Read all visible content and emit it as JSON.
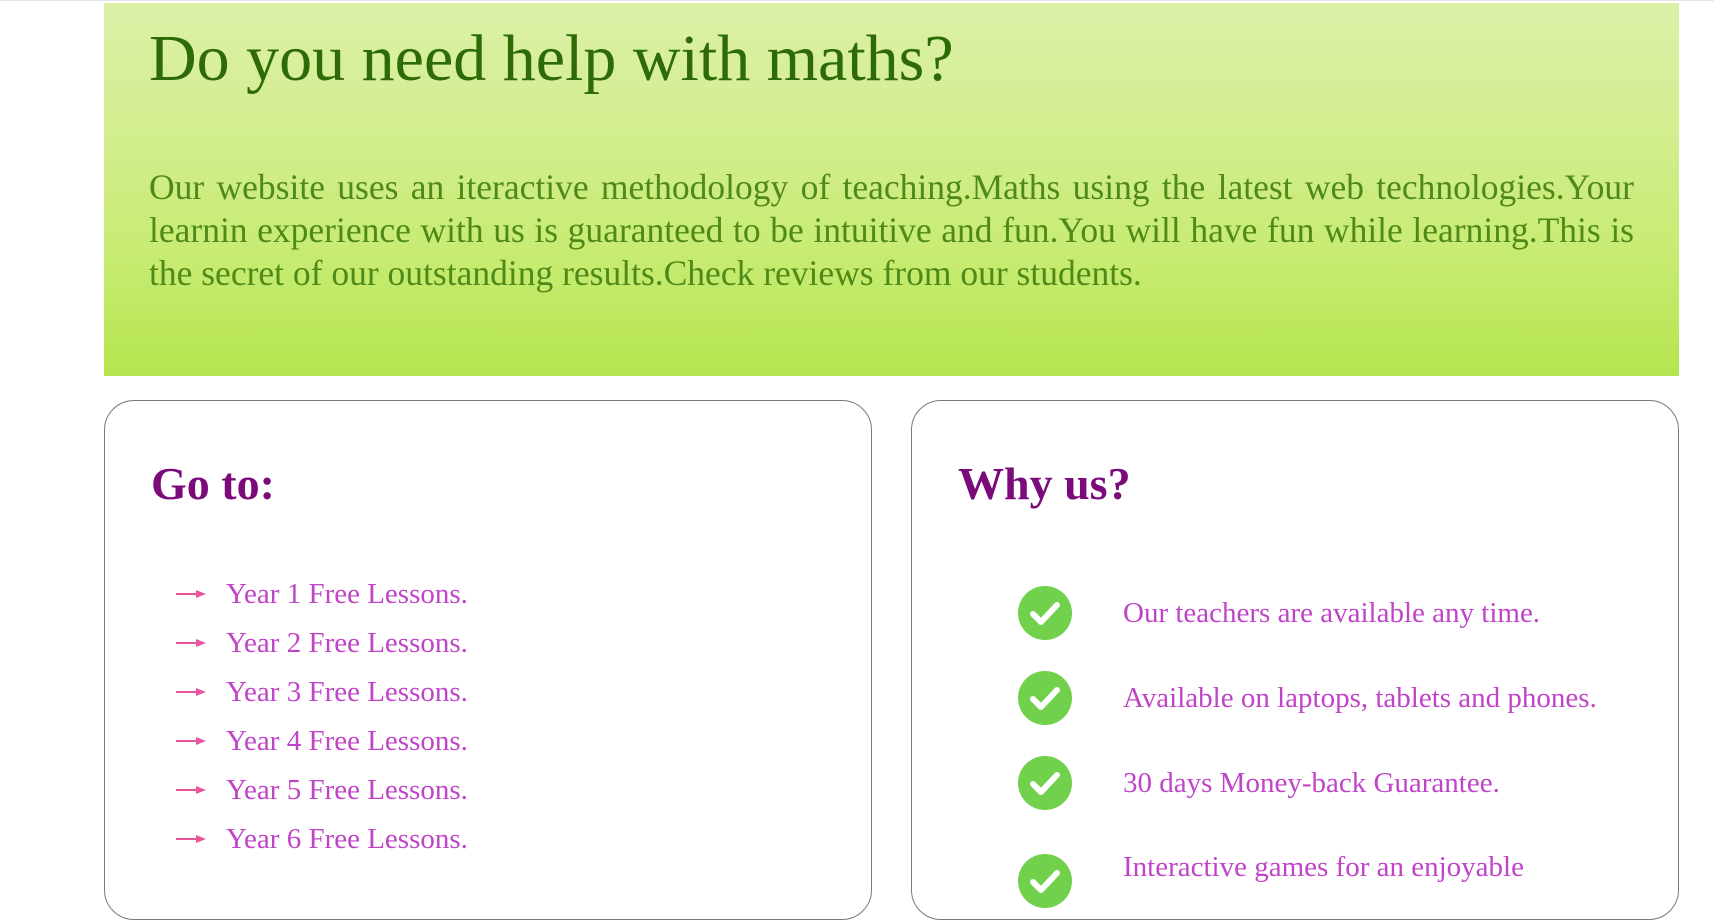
{
  "hero": {
    "title": "Do you need help with maths?",
    "text": "Our website uses an iteractive methodology of teaching.Maths using the latest web technologies.Your learnin experience with us is guaranteed to be intuitive and fun.You will have fun while learning.This is the secret of our outstanding results.Check reviews from our students."
  },
  "goto": {
    "heading": "Go to:",
    "items": [
      {
        "label": "Year 1 Free Lessons.",
        "icon": "arrow-right-icon"
      },
      {
        "label": "Year 2 Free Lessons.",
        "icon": "arrow-right-icon"
      },
      {
        "label": "Year 3 Free Lessons.",
        "icon": "arrow-right-icon"
      },
      {
        "label": "Year 4 Free Lessons.",
        "icon": "arrow-right-icon"
      },
      {
        "label": "Year 5 Free Lessons.",
        "icon": "arrow-right-icon"
      },
      {
        "label": "Year 6 Free Lessons.",
        "icon": "arrow-right-icon"
      }
    ]
  },
  "why": {
    "heading": "Why us?",
    "items": [
      {
        "label": "Our teachers are available any time.",
        "icon": "check-circle-icon"
      },
      {
        "label": "Available on laptops, tablets and phones.",
        "icon": "check-circle-icon"
      },
      {
        "label": "30 days Money-back Guarantee.",
        "icon": "check-circle-icon"
      },
      {
        "label": "Interactive games for an enjoyable",
        "icon": "check-circle-icon"
      }
    ]
  },
  "colors": {
    "hero_title": "#2e6b06",
    "hero_text": "#4f8a18",
    "heading": "#7b0a7b",
    "link": "#c044c8",
    "arrow": "#e8559a",
    "check": "#72d14c"
  }
}
